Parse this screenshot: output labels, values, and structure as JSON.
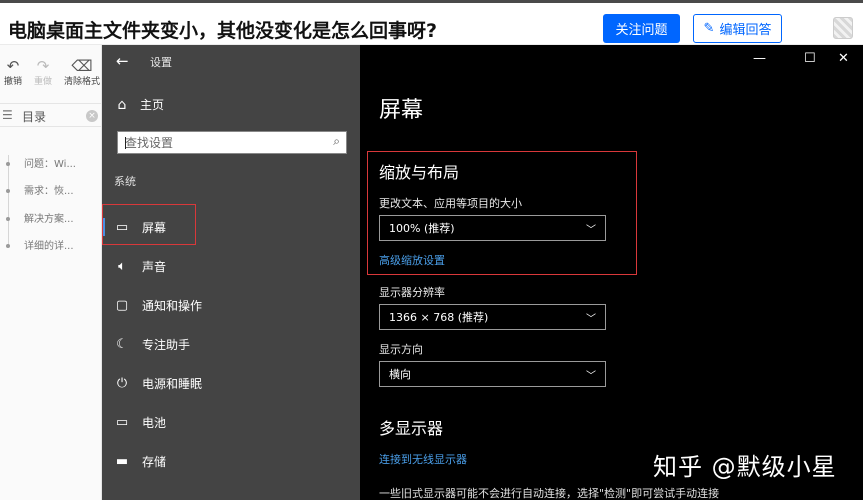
{
  "header": {
    "question_title": "电脑桌面主文件夹变小，其他没变化是怎么回事呀?",
    "follow_label": "关注问题",
    "edit_label": "编辑回答"
  },
  "editor": {
    "tools": [
      {
        "label": "撤销",
        "icon": "undo-icon"
      },
      {
        "label": "重做",
        "icon": "redo-icon"
      },
      {
        "label": "清除格式",
        "icon": "eraser-icon"
      }
    ],
    "toc_label": "目录",
    "toc_items": [
      "问题：Wi...",
      "需求：恢...",
      "解决方案...",
      "详细的详..."
    ]
  },
  "settings": {
    "window_title": "设置",
    "home_label": "主页",
    "search_placeholder": "查找设置",
    "section_label": "系统",
    "nav_items": [
      {
        "label": "屏幕",
        "icon": "monitor-icon",
        "active": true
      },
      {
        "label": "声音",
        "icon": "speaker-icon",
        "active": false
      },
      {
        "label": "通知和操作",
        "icon": "notification-icon",
        "active": false
      },
      {
        "label": "专注助手",
        "icon": "moon-icon",
        "active": false
      },
      {
        "label": "电源和睡眠",
        "icon": "power-icon",
        "active": false
      },
      {
        "label": "电池",
        "icon": "battery-icon",
        "active": false
      },
      {
        "label": "存储",
        "icon": "storage-icon",
        "active": false
      }
    ],
    "page_heading": "屏幕",
    "scale_heading": "缩放与布局",
    "scale_label": "更改文本、应用等项目的大小",
    "scale_value": "100% (推荐)",
    "advanced_link": "高级缩放设置",
    "resolution_label": "显示器分辨率",
    "resolution_value": "1366 × 768 (推荐)",
    "orientation_label": "显示方向",
    "orientation_value": "横向",
    "multi_heading": "多显示器",
    "wireless_link": "连接到无线显示器",
    "cut_text": "一些旧式显示器可能不会进行自动连接，选择\"检测\"即可尝试手动连接"
  },
  "watermark": "知乎 @默级小星",
  "colors": {
    "zhihu_blue": "#0066ff",
    "nav_bg": "#444444",
    "content_bg": "#000000",
    "highlight_red": "#d9383a",
    "link_blue": "#4a9ee8"
  }
}
